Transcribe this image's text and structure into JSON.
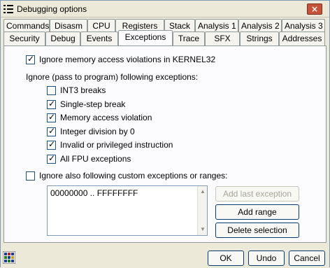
{
  "window": {
    "title": "Debugging options",
    "close_label": "×"
  },
  "tabs_row1": [
    "Commands",
    "Disasm",
    "CPU",
    "Registers",
    "Stack",
    "Analysis 1",
    "Analysis 2",
    "Analysis 3"
  ],
  "tabs_row2": [
    "Security",
    "Debug",
    "Events",
    "Exceptions",
    "Trace",
    "SFX",
    "Strings",
    "Addresses"
  ],
  "active_tab": "Exceptions",
  "exceptions": {
    "ignore_kernel32": {
      "label": "Ignore memory access violations in KERNEL32",
      "checked": true
    },
    "ignore_group_label": "Ignore (pass to program) following exceptions:",
    "items": [
      {
        "label": "INT3 breaks",
        "checked": false
      },
      {
        "label": "Single-step break",
        "checked": true
      },
      {
        "label": "Memory access violation",
        "checked": true
      },
      {
        "label": "Integer division by 0",
        "checked": true
      },
      {
        "label": "Invalid or privileged instruction",
        "checked": true
      },
      {
        "label": "All FPU exceptions",
        "checked": true
      }
    ],
    "custom": {
      "label": "Ignore also following custom exceptions or ranges:",
      "checked": false
    },
    "ranges": [
      "00000000 .. FFFFFFFF"
    ],
    "buttons": {
      "add_last": "Add last exception",
      "add_range": "Add range",
      "delete_selection": "Delete selection"
    }
  },
  "footer": {
    "ok": "OK",
    "undo": "Undo",
    "cancel": "Cancel"
  }
}
